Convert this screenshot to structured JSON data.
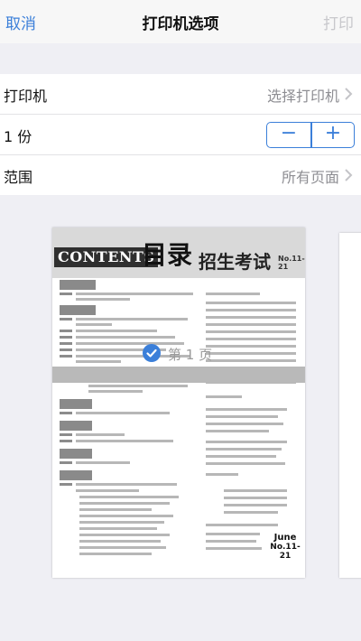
{
  "nav": {
    "cancel": "取消",
    "title": "打印机选项",
    "print": "打印"
  },
  "options": {
    "printer": {
      "label": "打印机",
      "value": "选择打印机"
    },
    "copies": {
      "label": "1 份",
      "minus": "−",
      "plus": "+"
    },
    "range": {
      "label": "范围",
      "value": "所有页面"
    }
  },
  "preview": {
    "page_badge": "第 1 页",
    "magazine": {
      "contents": "CONTENTS",
      "mulu": "目录",
      "brand": "招生考试",
      "issue": "No.11-21",
      "june": "June",
      "june_sub": "No.11-21"
    }
  },
  "colors": {
    "accent": "#3b7fd9",
    "disabled": "#c8c8cc",
    "secondary_text": "#8e8e93"
  },
  "icons": {
    "chevron": "chevron-right-icon",
    "check": "checkmark-circle-icon"
  }
}
